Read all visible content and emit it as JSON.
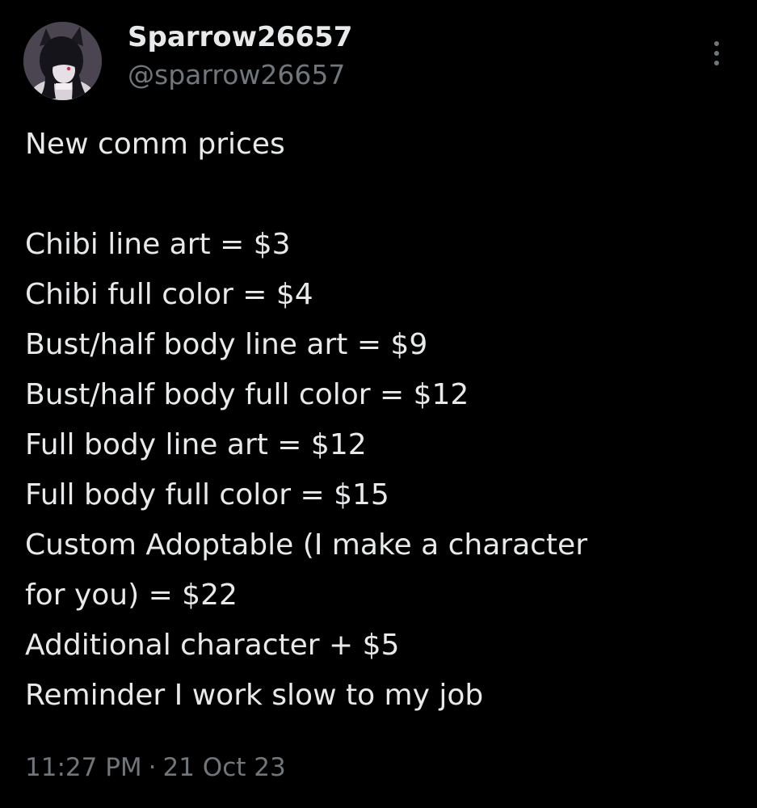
{
  "author": {
    "display_name": "Sparrow26657",
    "handle": "@sparrow26657",
    "avatar_icon": "avatar-image"
  },
  "more_icon": "more-options-icon",
  "tweet": {
    "lines": [
      "New comm prices",
      "",
      "Chibi line art = $3",
      "Chibi full color = $4",
      "Bust/half body line art = $9",
      "Bust/half body full color = $12",
      "Full body line art = $12",
      "Full body full color = $15",
      "Custom Adoptable (I make a character",
      "for you) = $22",
      "Additional character + $5",
      "Reminder I work slow to my job"
    ]
  },
  "meta": {
    "time": "11:27 PM",
    "separator": "·",
    "date": "21 Oct 23"
  },
  "colors": {
    "background": "#000000",
    "primary_text": "#e7e9ea",
    "secondary_text": "#71767b"
  }
}
